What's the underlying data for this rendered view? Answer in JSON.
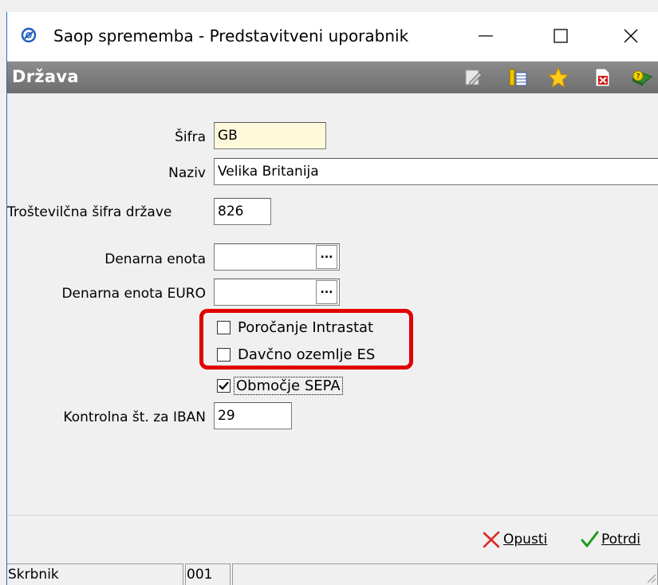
{
  "window": {
    "title": "Saop sprememba - Predstavitveni uporabnik",
    "minimize": "—",
    "maximize": "☐",
    "close": "✕"
  },
  "header": {
    "title": "Država",
    "tool_icons": [
      "edit-icon",
      "columns-icon",
      "star-icon",
      "delete-icon",
      "help-book-icon"
    ]
  },
  "form": {
    "sifra_label": "Šifra",
    "sifra_value": "GB",
    "naziv_label": "Naziv",
    "naziv_value": "Velika Britanija",
    "trostevilcna_label": "Troštevilčna šifra države",
    "trostevilcna_value": "826",
    "denarna_enota_label": "Denarna enota",
    "denarna_enota_value": "",
    "denarna_enota_euro_label": "Denarna enota EURO",
    "denarna_enota_euro_value": "",
    "lookup_button": "...",
    "porocanje_label": "Poročanje Intrastat",
    "porocanje_checked": false,
    "davcno_label": "Davčno ozemlje ES",
    "davcno_checked": false,
    "sepa_label": "Območje SEPA",
    "sepa_checked": true,
    "iban_label": "Kontrolna št. za IBAN",
    "iban_value": "29"
  },
  "actions": {
    "cancel_prefix": "",
    "cancel_label": "Opusti",
    "confirm_label": "Potrdi"
  },
  "statusbar": {
    "user": "Skrbnik",
    "code": "001",
    "extra": ""
  },
  "colors": {
    "header_bg": "#7d7d7d",
    "highlight": "#e10000",
    "field_yellow": "#fff9dc",
    "titlebar_accent": "#1b6fc8"
  }
}
